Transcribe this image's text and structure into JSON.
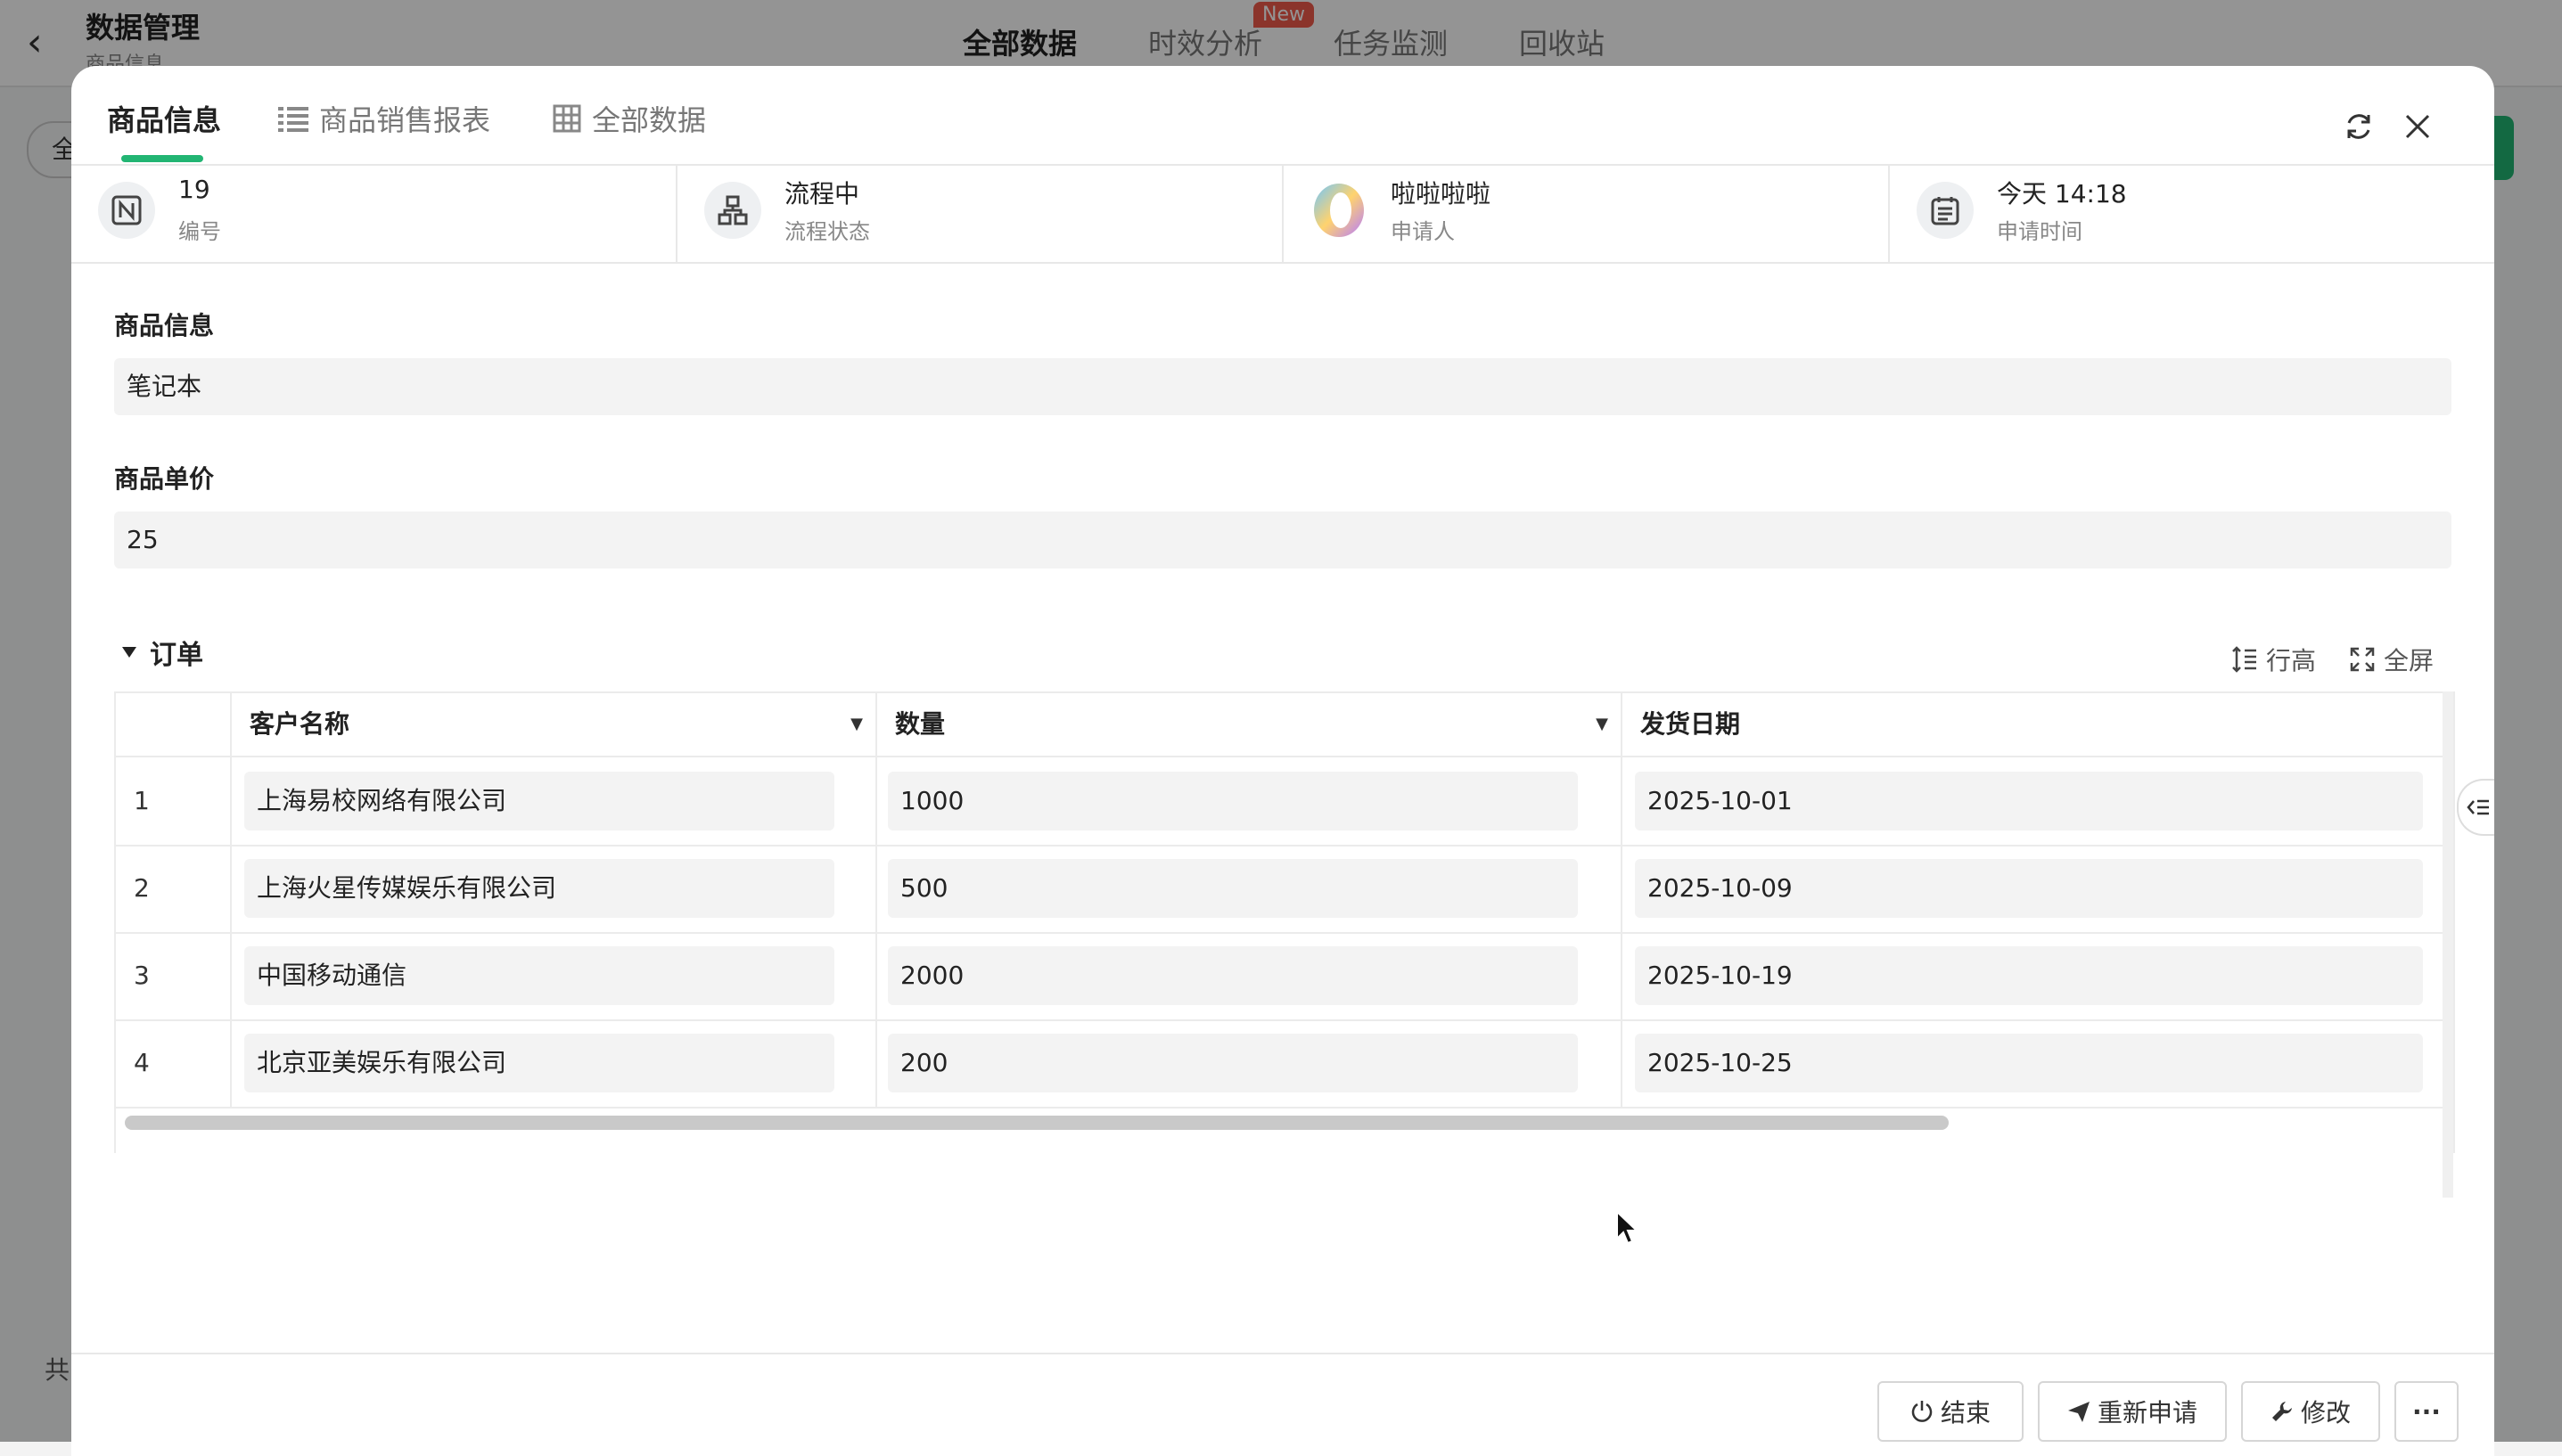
{
  "background": {
    "title": "数据管理",
    "subtitle": "商品信息",
    "tabs": [
      "全部数据",
      "时效分析",
      "任务监测",
      "回收站"
    ],
    "new_badge": "New",
    "left_btn": "全",
    "total_label": "共"
  },
  "modal": {
    "tabs": [
      {
        "label": "商品信息"
      },
      {
        "label": "商品销售报表"
      },
      {
        "label": "全部数据"
      }
    ],
    "info": [
      {
        "value": "19",
        "label": "编号",
        "icon": "number-icon"
      },
      {
        "value": "流程中",
        "label": "流程状态",
        "icon": "workflow-icon"
      },
      {
        "value": "啦啦啦啦",
        "label": "申请人",
        "icon": "avatar"
      },
      {
        "value": "今天 14:18",
        "label": "申请时间",
        "icon": "calendar-icon"
      }
    ],
    "fields": [
      {
        "label": "商品信息",
        "value": "笔记本"
      },
      {
        "label": "商品单价",
        "value": "25"
      }
    ],
    "subtable": {
      "title": "订单",
      "tools": {
        "row_height": "行高",
        "fullscreen": "全屏"
      },
      "columns": [
        "客户名称",
        "数量",
        "发货日期"
      ],
      "rows": [
        {
          "index": "1",
          "customer": "上海易校网络有限公司",
          "quantity": "1000",
          "date": "2025-10-01"
        },
        {
          "index": "2",
          "customer": "上海火星传媒娱乐有限公司",
          "quantity": "500",
          "date": "2025-10-09"
        },
        {
          "index": "3",
          "customer": "中国移动通信",
          "quantity": "2000",
          "date": "2025-10-19"
        },
        {
          "index": "4",
          "customer": "北京亚美娱乐有限公司",
          "quantity": "200",
          "date": "2025-10-25"
        }
      ]
    },
    "footer": {
      "end": "结束",
      "reapply": "重新申请",
      "edit": "修改",
      "more": "···"
    }
  },
  "colors": {
    "accent": "#22b573",
    "badge": "#f05a4b"
  }
}
